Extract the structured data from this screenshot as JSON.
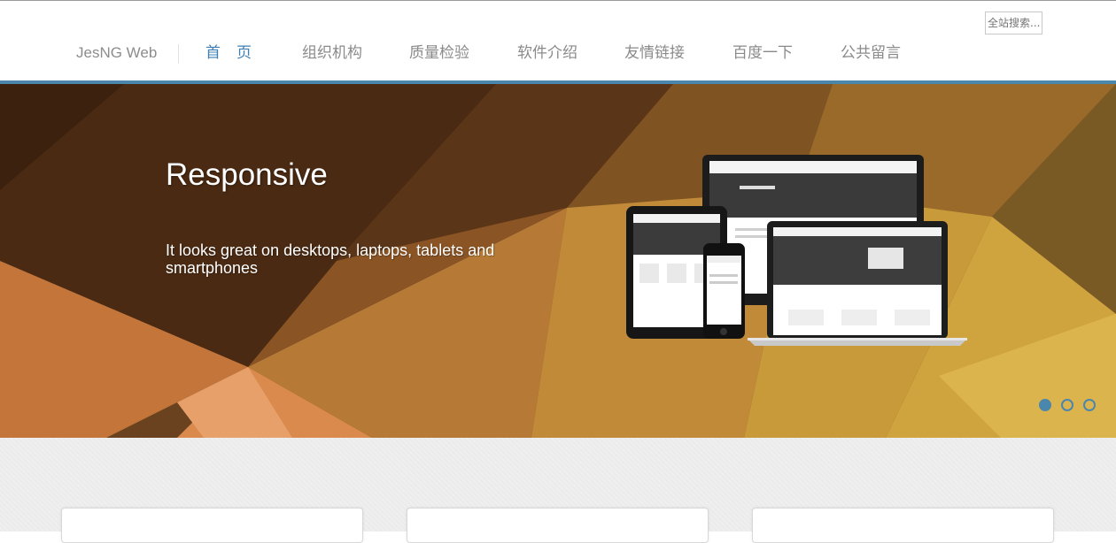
{
  "header": {
    "brand": "JesNG Web",
    "search_placeholder": "全站搜索...",
    "nav": [
      {
        "label": "首页"
      },
      {
        "label": "组织机构"
      },
      {
        "label": "质量检验"
      },
      {
        "label": "软件介绍"
      },
      {
        "label": "友情链接"
      },
      {
        "label": "百度一下"
      },
      {
        "label": "公共留言"
      }
    ]
  },
  "hero": {
    "title": "Responsive",
    "subtitle": "It looks great on desktops, laptops, tablets and smartphones",
    "slides": 3,
    "active_slide": 1,
    "devices_image": "responsive-devices-mockup"
  },
  "colors": {
    "accent": "#4b86ac",
    "nav_active": "#3e7fb6",
    "nav_text": "#8a8a8a",
    "hero_dark": "#4a2a12",
    "hero_orange": "#c46f2e",
    "hero_gold": "#c9a033",
    "lower_bg": "#efefef"
  }
}
